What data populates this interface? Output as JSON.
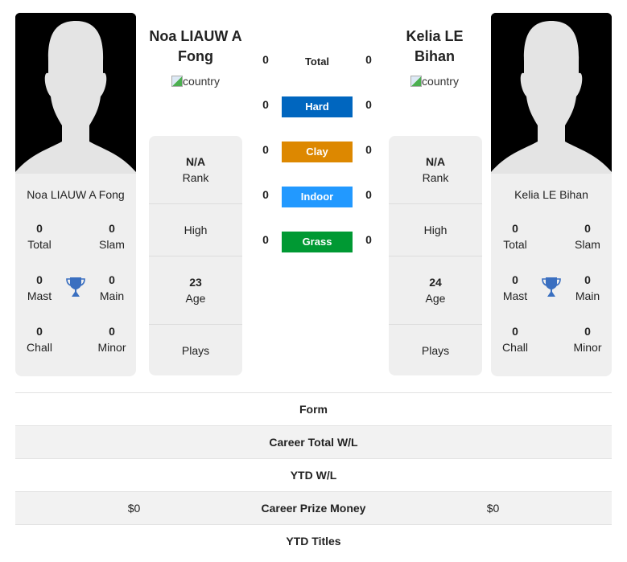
{
  "players": [
    {
      "name": "Noa LIAUW A Fong",
      "name_line1": "Noa LIAUW A",
      "name_line2": "Fong",
      "country_alt": "country",
      "rank": "N/A",
      "rank_label": "Rank",
      "high_label": "High",
      "age": "23",
      "age_label": "Age",
      "plays_label": "Plays",
      "titles": {
        "total": "0",
        "total_label": "Total",
        "slam": "0",
        "slam_label": "Slam",
        "mast": "0",
        "mast_label": "Mast",
        "main": "0",
        "main_label": "Main",
        "chall": "0",
        "chall_label": "Chall",
        "minor": "0",
        "minor_label": "Minor"
      }
    },
    {
      "name": "Kelia LE Bihan",
      "name_line1": "Kelia LE",
      "name_line2": "Bihan",
      "country_alt": "country",
      "rank": "N/A",
      "rank_label": "Rank",
      "high_label": "High",
      "age": "24",
      "age_label": "Age",
      "plays_label": "Plays",
      "titles": {
        "total": "0",
        "total_label": "Total",
        "slam": "0",
        "slam_label": "Slam",
        "mast": "0",
        "mast_label": "Mast",
        "main": "0",
        "main_label": "Main",
        "chall": "0",
        "chall_label": "Chall",
        "minor": "0",
        "minor_label": "Minor"
      }
    }
  ],
  "surfaces": [
    {
      "label": "Total",
      "left": "0",
      "right": "0",
      "color": ""
    },
    {
      "label": "Hard",
      "left": "0",
      "right": "0",
      "color": "#0066bf"
    },
    {
      "label": "Clay",
      "left": "0",
      "right": "0",
      "color": "#dd8800"
    },
    {
      "label": "Indoor",
      "left": "0",
      "right": "0",
      "color": "#2299ff"
    },
    {
      "label": "Grass",
      "left": "0",
      "right": "0",
      "color": "#009933"
    }
  ],
  "comparison": [
    {
      "label": "Form",
      "left": "",
      "right": ""
    },
    {
      "label": "Career Total W/L",
      "left": "",
      "right": ""
    },
    {
      "label": "YTD W/L",
      "left": "",
      "right": ""
    },
    {
      "label": "Career Prize Money",
      "left": "$0",
      "right": "$0"
    },
    {
      "label": "YTD Titles",
      "left": "",
      "right": ""
    }
  ],
  "icons": {
    "trophy_color": "#3a6fc0"
  }
}
